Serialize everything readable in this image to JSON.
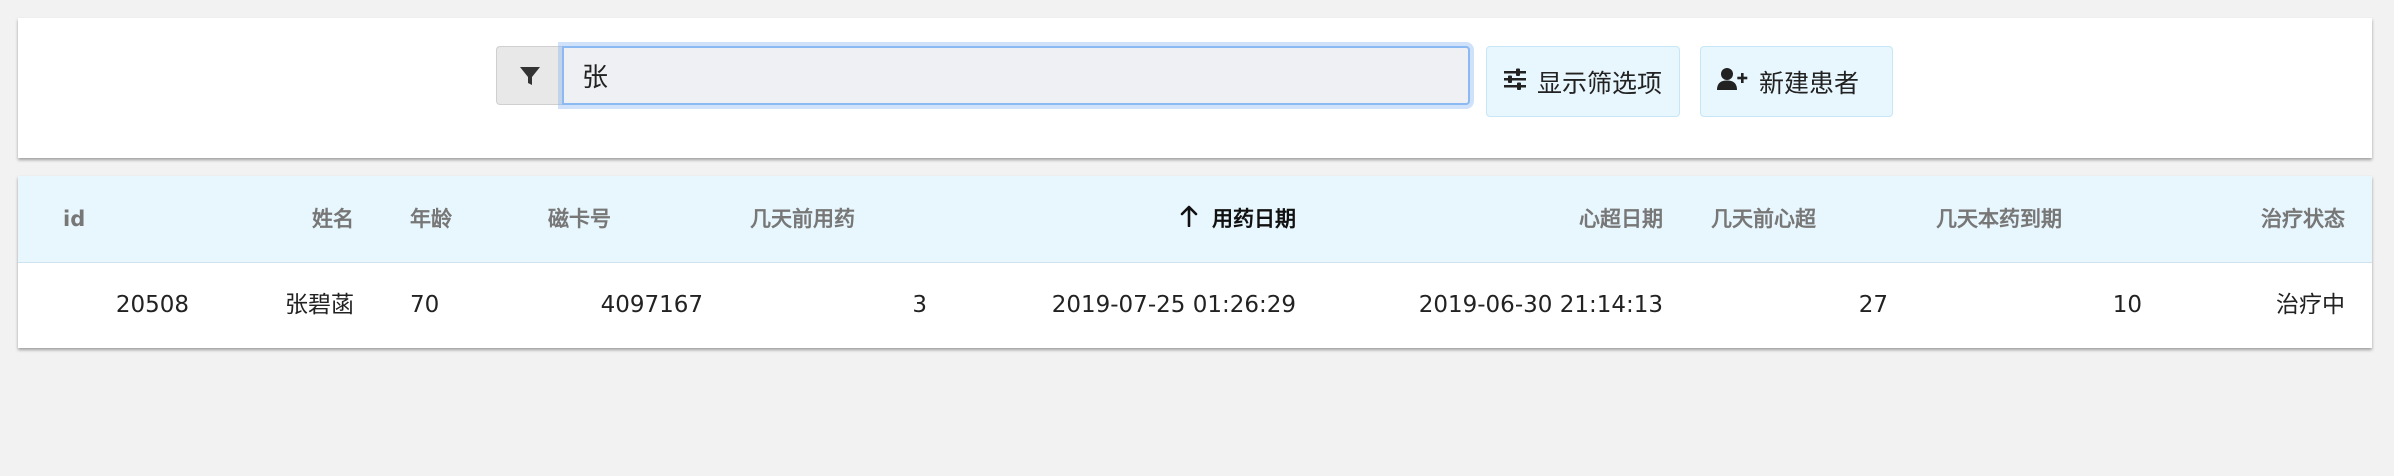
{
  "toolbar": {
    "search_value": "张",
    "icons": {
      "filter": "filter-icon",
      "sliders": "sliders-icon",
      "add_user": "user-plus-icon"
    },
    "show_filters_label": "显示筛选项",
    "new_patient_label": "新建患者"
  },
  "table": {
    "headers": {
      "id": "id",
      "name": "姓名",
      "age": "年龄",
      "card": "磁卡号",
      "days_since_med": "几天前用药",
      "med_date": "用药日期",
      "echo_date": "心超日期",
      "days_since_echo": "几天前心超",
      "days_to_expiry": "几天本药到期",
      "status": "治疗状态"
    },
    "sorted_column": "med_date",
    "rows": [
      {
        "id": "20508",
        "name": "张碧菡",
        "age": "70",
        "card": "4097167",
        "days_since_med": "3",
        "med_date": "2019-07-25 01:26:29",
        "echo_date": "2019-06-30 21:14:13",
        "days_since_echo": "27",
        "days_to_expiry": "10",
        "status": "治疗中"
      }
    ]
  },
  "colors": {
    "header_bg": "#e8f6fd",
    "button_bg": "#e8f6fd",
    "focus_border": "#8bb9f2"
  }
}
